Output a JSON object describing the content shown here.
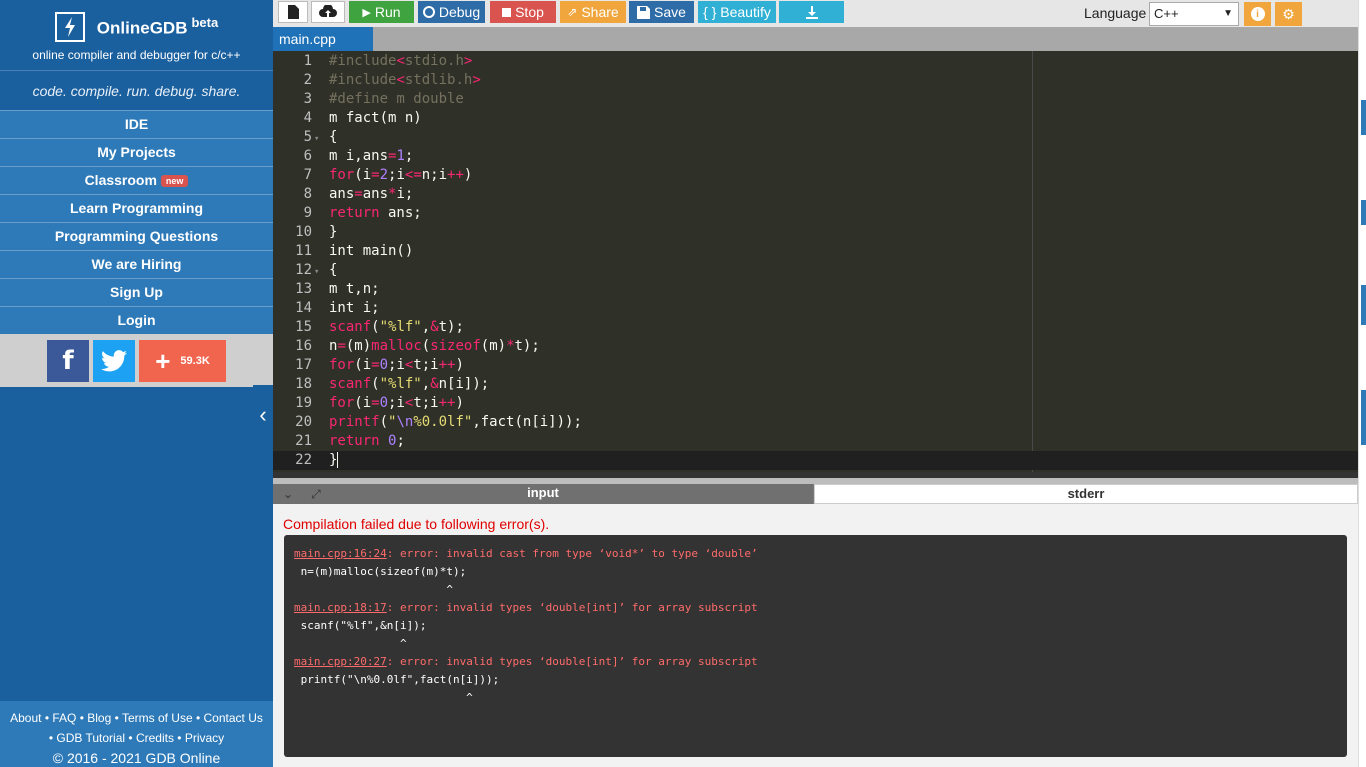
{
  "sidebar": {
    "brand_name": "OnlineGDB",
    "brand_beta": "beta",
    "brand_sub": "online compiler and debugger for c/c++",
    "tagline": "code. compile. run. debug. share.",
    "nav": [
      {
        "label": "IDE"
      },
      {
        "label": "My Projects"
      },
      {
        "label": "Classroom",
        "badge": "new"
      },
      {
        "label": "Learn Programming"
      },
      {
        "label": "Programming Questions"
      },
      {
        "label": "We are Hiring"
      },
      {
        "label": "Sign Up"
      },
      {
        "label": "Login"
      }
    ],
    "social": {
      "share_count": "59.3K"
    },
    "footer": {
      "about": "About",
      "faq": "FAQ",
      "blog": "Blog",
      "terms": "Terms of Use",
      "contact": "Contact Us",
      "tutorial": "GDB Tutorial",
      "credits": "Credits",
      "privacy": "Privacy",
      "copyright": "© 2016 - 2021 GDB Online"
    }
  },
  "toolbar": {
    "run": "Run",
    "debug": "Debug",
    "stop": "Stop",
    "share": "Share",
    "save": "Save",
    "beautify": "{ } Beautify",
    "language_label": "Language",
    "language_value": "C++",
    "colors": {
      "run": "#3fa33f",
      "debug": "#2e6ca8",
      "stop": "#d9534f",
      "share": "#f0a63c",
      "save": "#2e6ca8",
      "beautify": "#31b0d5",
      "download": "#31b0d5"
    }
  },
  "editor": {
    "file_tab": "main.cpp",
    "lines": [
      "1",
      "2",
      "3",
      "4",
      "5",
      "6",
      "7",
      "8",
      "9",
      "10",
      "11",
      "12",
      "13",
      "14",
      "15",
      "16",
      "17",
      "18",
      "19",
      "20",
      "21",
      "22"
    ]
  },
  "output": {
    "tab_input": "input",
    "tab_stderr": "stderr",
    "compile_message": "Compilation failed due to following error(s).",
    "errors": [
      {
        "loc": "main.cpp:16:24",
        "msg": ": error: invalid cast from type ‘void*’ to type ‘double’",
        "code": " n=(m)malloc(sizeof(m)*t);",
        "caret": "                       ^"
      },
      {
        "loc": "main.cpp:18:17",
        "msg": ": error: invalid types ‘double[int]’ for array subscript",
        "code": " scanf(\"%lf\",&n[i]);",
        "caret": "                ^"
      },
      {
        "loc": "main.cpp:20:27",
        "msg": ": error: invalid types ‘double[int]’ for array subscript",
        "code": " printf(\"\\n%0.0lf\",fact(n[i]));",
        "caret": "                          ^"
      }
    ]
  }
}
